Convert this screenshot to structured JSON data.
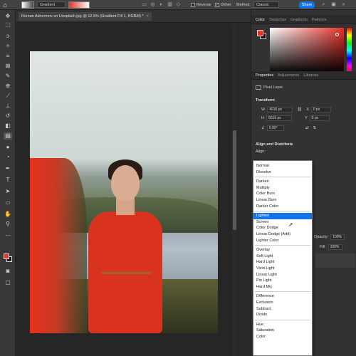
{
  "options_bar": {
    "tool_preset": "Gradient",
    "reverse_label": "Reverse",
    "dither_label": "Dither",
    "method_label": "Method:",
    "method_value": "Classic",
    "share_label": "Share"
  },
  "document": {
    "tab_title": "Roman Akhermov on Unsplash.jpg @ 12.5% (Gradient Fill 1, RGB/8) *",
    "close_glyph": "×"
  },
  "tools": [
    "move-icon",
    "marquee-icon",
    "lasso-icon",
    "magic-wand-icon",
    "crop-icon",
    "frame-icon",
    "eyedropper-icon",
    "healing-icon",
    "brush-icon",
    "stamp-icon",
    "history-brush-icon",
    "eraser-icon",
    "gradient-icon",
    "blur-icon",
    "dodge-icon",
    "pen-icon",
    "type-icon",
    "path-select-icon",
    "rectangle-icon",
    "hand-icon",
    "zoom-icon"
  ],
  "colors": {
    "foreground": "#e8322a",
    "background": "#111111",
    "accent": "#1473e6"
  },
  "color_panel": {
    "tabs": [
      "Color",
      "Swatches",
      "Gradients",
      "Patterns"
    ],
    "active_tab": "Color"
  },
  "properties_panel": {
    "tabs": [
      "Properties",
      "Adjustments",
      "Libraries"
    ],
    "active_tab": "Properties",
    "layer_kind": "Pixel Layer",
    "transform_title": "Transform",
    "w_label": "W",
    "w_value": "4016 px",
    "h_label": "H",
    "h_value": "6016 px",
    "x_label": "X",
    "x_value": "0 px",
    "y_label": "Y",
    "y_value": "0 px",
    "angle_value": "0.00°",
    "align_title": "Align and Distribute",
    "align_label": "Align:"
  },
  "layers_panel": {
    "opacity_label": "Opacity:",
    "opacity_value": "100%",
    "fill_label": "Fill:",
    "fill_value": "100%"
  },
  "blend_modes": {
    "selected": "Lighten",
    "groups": [
      [
        "Normal",
        "Dissolve"
      ],
      [
        "Darken",
        "Multiply",
        "Color Burn",
        "Linear Burn",
        "Darker Color"
      ],
      [
        "Lighten",
        "Screen",
        "Color Dodge",
        "Linear Dodge (Add)",
        "Lighter Color"
      ],
      [
        "Overlay",
        "Soft Light",
        "Hard Light",
        "Vivid Light",
        "Linear Light",
        "Pin Light",
        "Hard Mix"
      ],
      [
        "Difference",
        "Exclusion",
        "Subtract",
        "Divide"
      ],
      [
        "Hue",
        "Saturation",
        "Color"
      ]
    ]
  }
}
